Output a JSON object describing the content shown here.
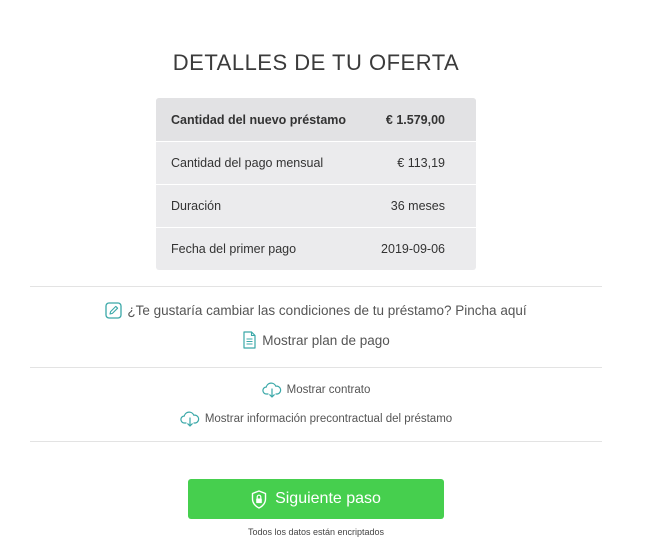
{
  "title": "DETALLES DE TU OFERTA",
  "offer": {
    "rows": [
      {
        "label": "Cantidad del nuevo préstamo",
        "value": "€ 1.579,00"
      },
      {
        "label": "Cantidad del pago mensual",
        "value": "€ 113,19"
      },
      {
        "label": "Duración",
        "value": "36 meses"
      },
      {
        "label": "Fecha del primer pago",
        "value": "2019-09-06"
      }
    ]
  },
  "links": {
    "change_conditions": "¿Te gustaría cambiar las condiciones de tu préstamo? Pincha aquí",
    "payment_plan": "Mostrar plan de pago",
    "contract": "Mostrar contrato",
    "precontract_info": "Mostrar información precontractual del préstamo"
  },
  "icons": {
    "change_conditions": "pencil-icon",
    "payment_plan": "document-icon",
    "contract": "cloud-download-icon",
    "precontract_info": "cloud-download-icon",
    "next": "shield-lock-icon"
  },
  "next_button": {
    "label": "Siguiente paso"
  },
  "encrypted_note": "Todos los datos están encriptados",
  "colors": {
    "accent": "#46cf4e",
    "icon": "#3aa8a8",
    "table_bg": "#ebebed"
  }
}
